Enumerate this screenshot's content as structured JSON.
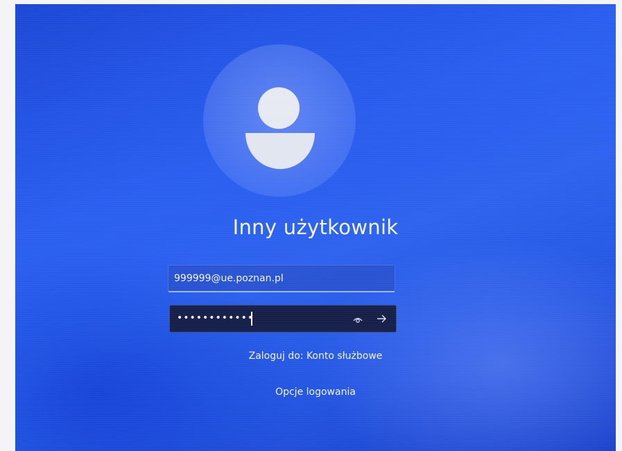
{
  "login": {
    "user_name": "Inny użytkownik",
    "email_value": "999999@ue.poznan.pl",
    "password_mask": "••••••••••••",
    "sign_in_to": "Zaloguj do: Konto służbowe",
    "sign_in_options": "Opcje logowania"
  },
  "icons": {
    "avatar": "user-icon",
    "reveal": "eye-icon",
    "submit": "arrow-right-icon"
  },
  "colors": {
    "background": "#2a5ff0",
    "password_field": "#172048",
    "input_accent": "#9db6ff"
  }
}
